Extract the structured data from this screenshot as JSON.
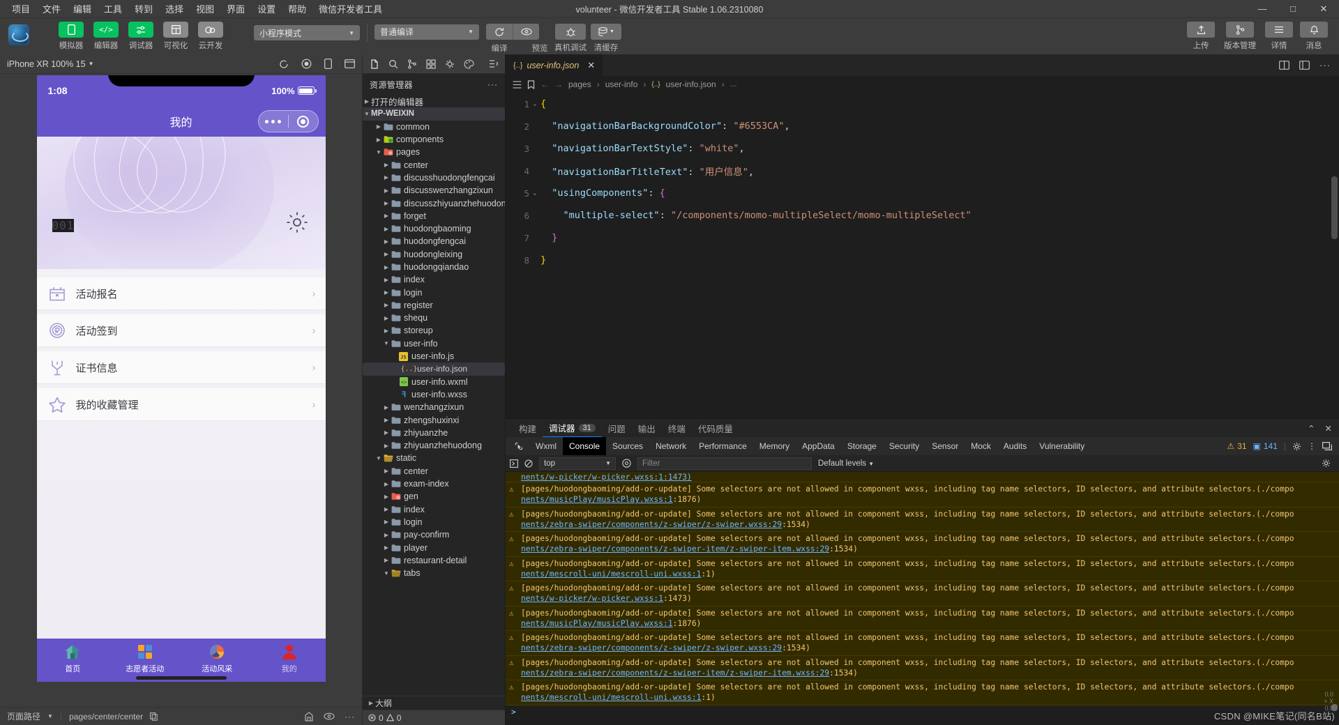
{
  "window": {
    "title": "volunteer - 微信开发者工具 Stable 1.06.2310080",
    "minimize": "—",
    "maximize": "□",
    "close": "✕"
  },
  "menu": [
    "项目",
    "文件",
    "编辑",
    "工具",
    "转到",
    "选择",
    "视图",
    "界面",
    "设置",
    "帮助",
    "微信开发者工具"
  ],
  "toolbar": {
    "buttons": [
      {
        "label": "模拟器",
        "icon": "phone-icon",
        "style": "green"
      },
      {
        "label": "编辑器",
        "icon": "code-icon",
        "style": "green"
      },
      {
        "label": "调试器",
        "icon": "sliders-icon",
        "style": "green"
      },
      {
        "label": "可视化",
        "icon": "layout-icon",
        "style": "gray"
      },
      {
        "label": "云开发",
        "icon": "cloud-icon",
        "style": "gray"
      }
    ],
    "mode_select": "小程序模式",
    "compile_select": "普通编译",
    "compile_label": "编译",
    "preview_label": "预览",
    "realdevice_label": "真机调试",
    "clearcache_label": "清缓存",
    "right_buttons": [
      {
        "label": "上传",
        "icon": "upload-icon"
      },
      {
        "label": "版本管理",
        "icon": "branch-icon"
      },
      {
        "label": "详情",
        "icon": "menu-icon"
      },
      {
        "label": "消息",
        "icon": "bell-icon"
      }
    ]
  },
  "simulator": {
    "device": "iPhone XR 100% 15",
    "status_time": "1:08",
    "battery": "100%",
    "nav_title": "我的",
    "hero_code": "001",
    "rows": [
      {
        "label": "活动报名",
        "icon": "activity-signup-icon"
      },
      {
        "label": "活动签到",
        "icon": "check-in-icon"
      },
      {
        "label": "证书信息",
        "icon": "certificate-icon"
      },
      {
        "label": "我的收藏管理",
        "icon": "star-icon"
      }
    ],
    "tabs": [
      {
        "label": "首页",
        "icon": "home-icon",
        "active": false
      },
      {
        "label": "志愿者活动",
        "icon": "blocks-icon",
        "active": false
      },
      {
        "label": "活动风采",
        "icon": "ball-icon",
        "active": false
      },
      {
        "label": "我的",
        "icon": "person-icon",
        "active": true
      }
    ],
    "footer_path_label": "页面路径",
    "footer_path": "pages/center/center"
  },
  "explorer": {
    "title": "资源管理器",
    "more": "···",
    "open_editors": "打开的编辑器",
    "project": "MP-WEIXIN",
    "outline": "大纲",
    "problems": {
      "errors": "0",
      "warnings": "0"
    },
    "tree": [
      {
        "label": "common",
        "depth": 1,
        "type": "folder",
        "open": false
      },
      {
        "label": "components",
        "depth": 1,
        "type": "folder-green",
        "open": false
      },
      {
        "label": "pages",
        "depth": 1,
        "type": "folder-red",
        "open": true
      },
      {
        "label": "center",
        "depth": 2,
        "type": "folder",
        "open": false
      },
      {
        "label": "discusshuodongfengcai",
        "depth": 2,
        "type": "folder",
        "open": false
      },
      {
        "label": "discusswenzhangzixun",
        "depth": 2,
        "type": "folder",
        "open": false
      },
      {
        "label": "discusszhiyuanzhehuodong",
        "depth": 2,
        "type": "folder",
        "open": false
      },
      {
        "label": "forget",
        "depth": 2,
        "type": "folder",
        "open": false
      },
      {
        "label": "huodongbaoming",
        "depth": 2,
        "type": "folder",
        "open": false
      },
      {
        "label": "huodongfengcai",
        "depth": 2,
        "type": "folder",
        "open": false
      },
      {
        "label": "huodongleixing",
        "depth": 2,
        "type": "folder",
        "open": false
      },
      {
        "label": "huodongqiandao",
        "depth": 2,
        "type": "folder",
        "open": false
      },
      {
        "label": "index",
        "depth": 2,
        "type": "folder",
        "open": false
      },
      {
        "label": "login",
        "depth": 2,
        "type": "folder",
        "open": false
      },
      {
        "label": "register",
        "depth": 2,
        "type": "folder",
        "open": false
      },
      {
        "label": "shequ",
        "depth": 2,
        "type": "folder",
        "open": false
      },
      {
        "label": "storeup",
        "depth": 2,
        "type": "folder",
        "open": false
      },
      {
        "label": "user-info",
        "depth": 2,
        "type": "folder",
        "open": true
      },
      {
        "label": "user-info.js",
        "depth": 3,
        "type": "js",
        "open": false
      },
      {
        "label": "user-info.json",
        "depth": 3,
        "type": "json",
        "open": false,
        "selected": true
      },
      {
        "label": "user-info.wxml",
        "depth": 3,
        "type": "wxml",
        "open": false
      },
      {
        "label": "user-info.wxss",
        "depth": 3,
        "type": "wxss",
        "open": false
      },
      {
        "label": "wenzhangzixun",
        "depth": 2,
        "type": "folder",
        "open": false
      },
      {
        "label": "zhengshuxinxi",
        "depth": 2,
        "type": "folder",
        "open": false
      },
      {
        "label": "zhiyuanzhe",
        "depth": 2,
        "type": "folder",
        "open": false
      },
      {
        "label": "zhiyuanzhehuodong",
        "depth": 2,
        "type": "folder",
        "open": false
      },
      {
        "label": "static",
        "depth": 1,
        "type": "folder-yellow",
        "open": true
      },
      {
        "label": "center",
        "depth": 2,
        "type": "folder",
        "open": false
      },
      {
        "label": "exam-index",
        "depth": 2,
        "type": "folder",
        "open": false
      },
      {
        "label": "gen",
        "depth": 2,
        "type": "folder-red",
        "open": false
      },
      {
        "label": "index",
        "depth": 2,
        "type": "folder",
        "open": false
      },
      {
        "label": "login",
        "depth": 2,
        "type": "folder",
        "open": false
      },
      {
        "label": "pay-confirm",
        "depth": 2,
        "type": "folder",
        "open": false
      },
      {
        "label": "player",
        "depth": 2,
        "type": "folder",
        "open": false
      },
      {
        "label": "restaurant-detail",
        "depth": 2,
        "type": "folder",
        "open": false
      },
      {
        "label": "tabs",
        "depth": 2,
        "type": "folder-open",
        "open": true
      }
    ]
  },
  "editor": {
    "tab": {
      "name": "user-info.json",
      "icon": "json-icon",
      "close": "✕"
    },
    "breadcrumb": [
      "pages",
      "user-info",
      "user-info.json",
      "…"
    ],
    "lines": [
      {
        "n": "1",
        "fold": "v",
        "segments": [
          {
            "t": "{",
            "c": "br"
          }
        ]
      },
      {
        "n": "2",
        "fold": "",
        "segments": [
          {
            "t": "  ",
            "c": "p"
          },
          {
            "t": "\"navigationBarBackgroundColor\"",
            "c": "k"
          },
          {
            "t": ": ",
            "c": "p"
          },
          {
            "t": "\"#6553CA\"",
            "c": "s"
          },
          {
            "t": ",",
            "c": "p"
          }
        ]
      },
      {
        "n": "3",
        "fold": "",
        "segments": [
          {
            "t": "  ",
            "c": "p"
          },
          {
            "t": "\"navigationBarTextStyle\"",
            "c": "k"
          },
          {
            "t": ": ",
            "c": "p"
          },
          {
            "t": "\"white\"",
            "c": "s"
          },
          {
            "t": ",",
            "c": "p"
          }
        ]
      },
      {
        "n": "4",
        "fold": "",
        "segments": [
          {
            "t": "  ",
            "c": "p"
          },
          {
            "t": "\"navigationBarTitleText\"",
            "c": "k"
          },
          {
            "t": ": ",
            "c": "p"
          },
          {
            "t": "\"用户信息\"",
            "c": "s"
          },
          {
            "t": ",",
            "c": "p"
          }
        ]
      },
      {
        "n": "5",
        "fold": "v",
        "segments": [
          {
            "t": "  ",
            "c": "p"
          },
          {
            "t": "\"usingComponents\"",
            "c": "k"
          },
          {
            "t": ": ",
            "c": "p"
          },
          {
            "t": "{",
            "c": "bp"
          }
        ]
      },
      {
        "n": "6",
        "fold": "",
        "segments": [
          {
            "t": "    ",
            "c": "p"
          },
          {
            "t": "\"multiple-select\"",
            "c": "k"
          },
          {
            "t": ": ",
            "c": "p"
          },
          {
            "t": "\"/components/momo-multipleSelect/momo-multipleSelect\"",
            "c": "s"
          }
        ]
      },
      {
        "n": "7",
        "fold": "",
        "segments": [
          {
            "t": "  ",
            "c": "p"
          },
          {
            "t": "}",
            "c": "bp"
          }
        ]
      },
      {
        "n": "8",
        "fold": "",
        "segments": [
          {
            "t": "}",
            "c": "br"
          }
        ]
      }
    ]
  },
  "devtools": {
    "top_tabs": [
      {
        "label": "构建",
        "active": false
      },
      {
        "label": "调试器",
        "active": true,
        "badge": "31"
      },
      {
        "label": "问题",
        "active": false
      },
      {
        "label": "输出",
        "active": false
      },
      {
        "label": "终端",
        "active": false
      },
      {
        "label": "代码质量",
        "active": false
      }
    ],
    "panel_tabs": [
      "Wxml",
      "Console",
      "Sources",
      "Network",
      "Performance",
      "Memory",
      "AppData",
      "Storage",
      "Security",
      "Sensor",
      "Mock",
      "Audits",
      "Vulnerability"
    ],
    "active_panel": "Console",
    "warn_count": "31",
    "info_count": "141",
    "context": "top",
    "filter_placeholder": "Filter",
    "levels": "Default levels",
    "logs": [
      {
        "clipped_top": true,
        "text": "nents/w-picker/w-picker.wxss:1:1473)"
      },
      {
        "text": "[pages/huodongbaoming/add-or-update] Some selectors are not allowed in component wxss, including tag name selectors, ID selectors, and attribute selectors.(./compo",
        "link": "nents/musicPlay/musicPlay.wxss:1",
        "tail": ":1876)"
      },
      {
        "text": "[pages/huodongbaoming/add-or-update] Some selectors are not allowed in component wxss, including tag name selectors, ID selectors, and attribute selectors.(./compo",
        "link": "nents/zebra-swiper/components/z-swiper/z-swiper.wxss:29",
        "tail": ":1534)"
      },
      {
        "text": "[pages/huodongbaoming/add-or-update] Some selectors are not allowed in component wxss, including tag name selectors, ID selectors, and attribute selectors.(./compo",
        "link": "nents/zebra-swiper/components/z-swiper-item/z-swiper-item.wxss:29",
        "tail": ":1534)"
      },
      {
        "text": "[pages/huodongbaoming/add-or-update] Some selectors are not allowed in component wxss, including tag name selectors, ID selectors, and attribute selectors.(./compo",
        "link": "nents/mescroll-uni/mescroll-uni.wxss:1",
        "tail": ":1)"
      },
      {
        "text": "[pages/huodongbaoming/add-or-update] Some selectors are not allowed in component wxss, including tag name selectors, ID selectors, and attribute selectors.(./compo",
        "link": "nents/w-picker/w-picker.wxss:1",
        "tail": ":1473)"
      },
      {
        "text": "[pages/huodongbaoming/add-or-update] Some selectors are not allowed in component wxss, including tag name selectors, ID selectors, and attribute selectors.(./compo",
        "link": "nents/musicPlay/musicPlay.wxss:1",
        "tail": ":1876)"
      },
      {
        "text": "[pages/huodongbaoming/add-or-update] Some selectors are not allowed in component wxss, including tag name selectors, ID selectors, and attribute selectors.(./compo",
        "link": "nents/zebra-swiper/components/z-swiper/z-swiper.wxss:29",
        "tail": ":1534)"
      },
      {
        "text": "[pages/huodongbaoming/add-or-update] Some selectors are not allowed in component wxss, including tag name selectors, ID selectors, and attribute selectors.(./compo",
        "link": "nents/zebra-swiper/components/z-swiper-item/z-swiper-item.wxss:29",
        "tail": ":1534)"
      },
      {
        "text": "[pages/huodongbaoming/add-or-update] Some selectors are not allowed in component wxss, including tag name selectors, ID selectors, and attribute selectors.(./compo",
        "link": "nents/mescroll-uni/mescroll-uni.wxss:1",
        "tail": ":1)"
      }
    ],
    "prompt": ">"
  },
  "watermark": {
    "text": "CSDN @MIKE笔记(同名B站)",
    "nums": "0.0\n+ X\n0.0"
  },
  "colors": {
    "accent": "#6553CA",
    "green": "#07c160",
    "warn": "#e2b341"
  }
}
